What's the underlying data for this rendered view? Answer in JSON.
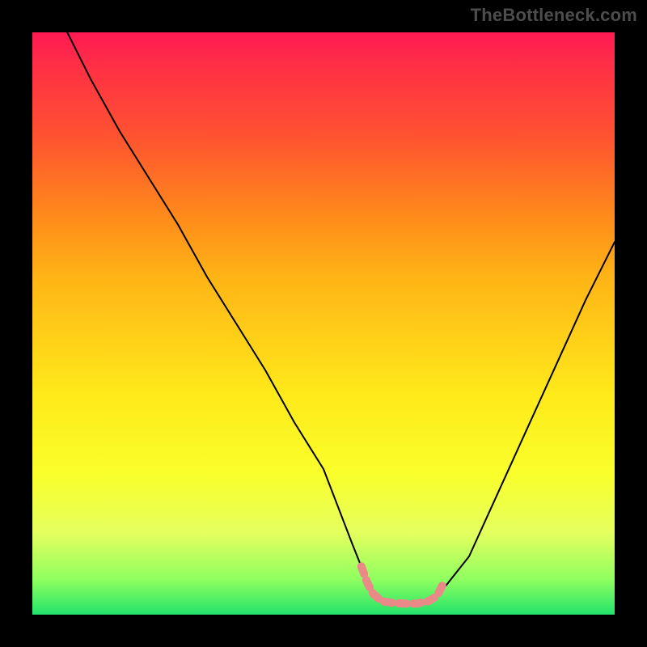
{
  "watermark": "TheBottleneck.com",
  "chart_data": {
    "type": "line",
    "title": "",
    "xlabel": "",
    "ylabel": "",
    "xlim": [
      0,
      100
    ],
    "ylim": [
      0,
      100
    ],
    "series": [
      {
        "name": "curve",
        "color": "#000000",
        "x": [
          6,
          10,
          15,
          20,
          25,
          30,
          35,
          40,
          45,
          50,
          55,
          57,
          58,
          60,
          62,
          64,
          66,
          68,
          70,
          75,
          80,
          85,
          90,
          95,
          100
        ],
        "y": [
          100,
          92,
          83,
          75,
          67,
          58,
          50,
          42,
          33,
          25,
          12,
          7,
          4,
          2.2,
          2.0,
          1.9,
          1.9,
          2.2,
          3.7,
          10,
          21,
          32,
          43,
          54,
          64
        ]
      },
      {
        "name": "highlight-segment",
        "color": "#e98a88",
        "thick": true,
        "x": [
          56.5,
          57.5,
          58.5,
          60.0,
          62.0,
          64.0,
          66.0,
          68.0,
          69.5,
          70.5
        ],
        "y": [
          8.3,
          5.5,
          3.6,
          2.3,
          2.0,
          1.9,
          1.9,
          2.3,
          3.2,
          5.2
        ]
      }
    ],
    "background_gradient": {
      "direction": "top-to-bottom",
      "stops": [
        {
          "pos": 0.0,
          "color": "#ff1a53"
        },
        {
          "pos": 0.06,
          "color": "#ff3045"
        },
        {
          "pos": 0.18,
          "color": "#ff5330"
        },
        {
          "pos": 0.32,
          "color": "#ff8c1a"
        },
        {
          "pos": 0.42,
          "color": "#ffb416"
        },
        {
          "pos": 0.62,
          "color": "#ffe91a"
        },
        {
          "pos": 0.76,
          "color": "#f9ff2b"
        },
        {
          "pos": 0.86,
          "color": "#e4ff5f"
        },
        {
          "pos": 0.94,
          "color": "#8eff5f"
        },
        {
          "pos": 1.0,
          "color": "#22e26b"
        }
      ]
    }
  }
}
